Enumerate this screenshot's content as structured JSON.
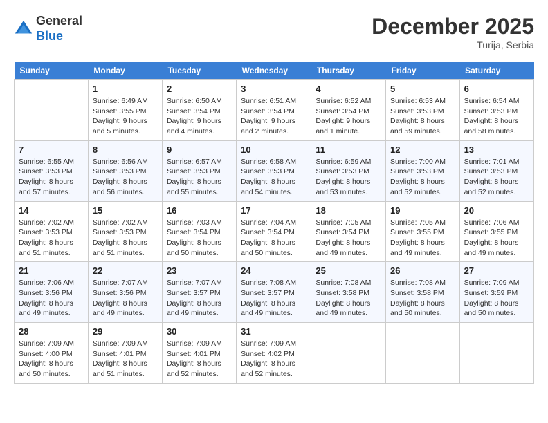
{
  "header": {
    "logo_line1": "General",
    "logo_line2": "Blue",
    "month": "December 2025",
    "location": "Turija, Serbia"
  },
  "weekdays": [
    "Sunday",
    "Monday",
    "Tuesday",
    "Wednesday",
    "Thursday",
    "Friday",
    "Saturday"
  ],
  "weeks": [
    [
      {
        "day": "",
        "info": ""
      },
      {
        "day": "1",
        "info": "Sunrise: 6:49 AM\nSunset: 3:55 PM\nDaylight: 9 hours\nand 5 minutes."
      },
      {
        "day": "2",
        "info": "Sunrise: 6:50 AM\nSunset: 3:54 PM\nDaylight: 9 hours\nand 4 minutes."
      },
      {
        "day": "3",
        "info": "Sunrise: 6:51 AM\nSunset: 3:54 PM\nDaylight: 9 hours\nand 2 minutes."
      },
      {
        "day": "4",
        "info": "Sunrise: 6:52 AM\nSunset: 3:54 PM\nDaylight: 9 hours\nand 1 minute."
      },
      {
        "day": "5",
        "info": "Sunrise: 6:53 AM\nSunset: 3:53 PM\nDaylight: 8 hours\nand 59 minutes."
      },
      {
        "day": "6",
        "info": "Sunrise: 6:54 AM\nSunset: 3:53 PM\nDaylight: 8 hours\nand 58 minutes."
      }
    ],
    [
      {
        "day": "7",
        "info": "Sunrise: 6:55 AM\nSunset: 3:53 PM\nDaylight: 8 hours\nand 57 minutes."
      },
      {
        "day": "8",
        "info": "Sunrise: 6:56 AM\nSunset: 3:53 PM\nDaylight: 8 hours\nand 56 minutes."
      },
      {
        "day": "9",
        "info": "Sunrise: 6:57 AM\nSunset: 3:53 PM\nDaylight: 8 hours\nand 55 minutes."
      },
      {
        "day": "10",
        "info": "Sunrise: 6:58 AM\nSunset: 3:53 PM\nDaylight: 8 hours\nand 54 minutes."
      },
      {
        "day": "11",
        "info": "Sunrise: 6:59 AM\nSunset: 3:53 PM\nDaylight: 8 hours\nand 53 minutes."
      },
      {
        "day": "12",
        "info": "Sunrise: 7:00 AM\nSunset: 3:53 PM\nDaylight: 8 hours\nand 52 minutes."
      },
      {
        "day": "13",
        "info": "Sunrise: 7:01 AM\nSunset: 3:53 PM\nDaylight: 8 hours\nand 52 minutes."
      }
    ],
    [
      {
        "day": "14",
        "info": "Sunrise: 7:02 AM\nSunset: 3:53 PM\nDaylight: 8 hours\nand 51 minutes."
      },
      {
        "day": "15",
        "info": "Sunrise: 7:02 AM\nSunset: 3:53 PM\nDaylight: 8 hours\nand 51 minutes."
      },
      {
        "day": "16",
        "info": "Sunrise: 7:03 AM\nSunset: 3:54 PM\nDaylight: 8 hours\nand 50 minutes."
      },
      {
        "day": "17",
        "info": "Sunrise: 7:04 AM\nSunset: 3:54 PM\nDaylight: 8 hours\nand 50 minutes."
      },
      {
        "day": "18",
        "info": "Sunrise: 7:05 AM\nSunset: 3:54 PM\nDaylight: 8 hours\nand 49 minutes."
      },
      {
        "day": "19",
        "info": "Sunrise: 7:05 AM\nSunset: 3:55 PM\nDaylight: 8 hours\nand 49 minutes."
      },
      {
        "day": "20",
        "info": "Sunrise: 7:06 AM\nSunset: 3:55 PM\nDaylight: 8 hours\nand 49 minutes."
      }
    ],
    [
      {
        "day": "21",
        "info": "Sunrise: 7:06 AM\nSunset: 3:56 PM\nDaylight: 8 hours\nand 49 minutes."
      },
      {
        "day": "22",
        "info": "Sunrise: 7:07 AM\nSunset: 3:56 PM\nDaylight: 8 hours\nand 49 minutes."
      },
      {
        "day": "23",
        "info": "Sunrise: 7:07 AM\nSunset: 3:57 PM\nDaylight: 8 hours\nand 49 minutes."
      },
      {
        "day": "24",
        "info": "Sunrise: 7:08 AM\nSunset: 3:57 PM\nDaylight: 8 hours\nand 49 minutes."
      },
      {
        "day": "25",
        "info": "Sunrise: 7:08 AM\nSunset: 3:58 PM\nDaylight: 8 hours\nand 49 minutes."
      },
      {
        "day": "26",
        "info": "Sunrise: 7:08 AM\nSunset: 3:58 PM\nDaylight: 8 hours\nand 50 minutes."
      },
      {
        "day": "27",
        "info": "Sunrise: 7:09 AM\nSunset: 3:59 PM\nDaylight: 8 hours\nand 50 minutes."
      }
    ],
    [
      {
        "day": "28",
        "info": "Sunrise: 7:09 AM\nSunset: 4:00 PM\nDaylight: 8 hours\nand 50 minutes."
      },
      {
        "day": "29",
        "info": "Sunrise: 7:09 AM\nSunset: 4:01 PM\nDaylight: 8 hours\nand 51 minutes."
      },
      {
        "day": "30",
        "info": "Sunrise: 7:09 AM\nSunset: 4:01 PM\nDaylight: 8 hours\nand 52 minutes."
      },
      {
        "day": "31",
        "info": "Sunrise: 7:09 AM\nSunset: 4:02 PM\nDaylight: 8 hours\nand 52 minutes."
      },
      {
        "day": "",
        "info": ""
      },
      {
        "day": "",
        "info": ""
      },
      {
        "day": "",
        "info": ""
      }
    ]
  ]
}
